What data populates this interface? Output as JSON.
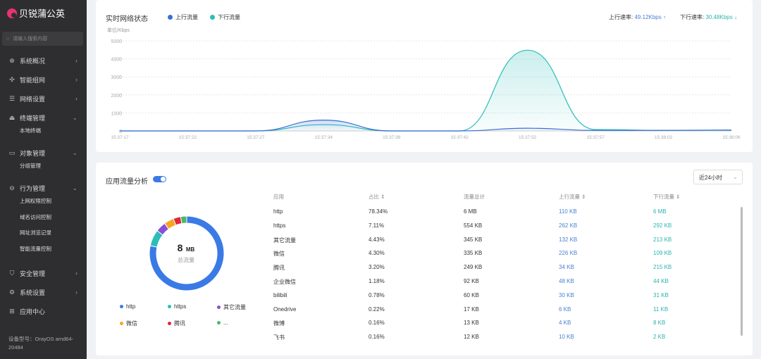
{
  "brand": "贝锐蒲公英",
  "search": {
    "placeholder": "请输入搜索内容"
  },
  "sidebar": {
    "items": [
      {
        "label": "系统概况",
        "icon": "globe-icon",
        "chevron": "right"
      },
      {
        "label": "智能组网",
        "icon": "network-icon",
        "chevron": "right"
      },
      {
        "label": "网络设置",
        "icon": "sliders-icon",
        "chevron": "right"
      },
      {
        "label": "终端管理",
        "icon": "terminal-icon",
        "chevron": "down",
        "children": [
          "本地终端"
        ]
      },
      {
        "label": "对象管理",
        "icon": "folder-icon",
        "chevron": "down",
        "children": [
          "分组管理"
        ]
      },
      {
        "label": "行为管理",
        "icon": "behavior-icon",
        "chevron": "down",
        "children": [
          "上网权限控制",
          "域名访问控制",
          "网址浏览记录",
          "智能流量控制"
        ]
      },
      {
        "label": "安全管理",
        "icon": "shield-icon",
        "chevron": "right"
      },
      {
        "label": "系统设置",
        "icon": "gear-icon",
        "chevron": "right"
      },
      {
        "label": "应用中心",
        "icon": "apps-icon",
        "chevron": ""
      }
    ],
    "device": "设备型号：OrayOS amd64-20484"
  },
  "realtime": {
    "title": "实时网络状态",
    "up_label": "上行流量",
    "down_label": "下行流量",
    "up_rate_label": "上行速率:",
    "up_rate": "49.12Kbps ↑",
    "down_rate_label": "下行速率:",
    "down_rate": "30.48Kbps ↓"
  },
  "chart_data": {
    "type": "area",
    "ylabel": "单位/Kbps",
    "ylim": [
      0,
      5000
    ],
    "yticks": [
      0,
      1000,
      2000,
      3000,
      4000,
      5000
    ],
    "grid": true,
    "legend": "top-left",
    "x": [
      "15:37:17",
      "15:37:22",
      "15:37:27",
      "15:37:34",
      "15:37:38",
      "15:37:42",
      "15:37:52",
      "15:37:57",
      "15:38:02",
      "15:38:06"
    ],
    "series": [
      {
        "name": "上行流量",
        "color": "#3b6fd4",
        "values": [
          0,
          0,
          0,
          600,
          0,
          0,
          150,
          30,
          30,
          50
        ]
      },
      {
        "name": "下行流量",
        "color": "#2bbdb8",
        "values": [
          0,
          0,
          0,
          350,
          0,
          0,
          4480,
          80,
          30,
          40
        ]
      }
    ]
  },
  "apps": {
    "title": "应用流量分析",
    "toggle_on": true,
    "range": "近24小时",
    "total_value": "8",
    "total_unit": "MB",
    "total_label": "总流量",
    "legend": [
      {
        "name": "http",
        "color": "#3b7ae6"
      },
      {
        "name": "https",
        "color": "#2cbdb8"
      },
      {
        "name": "其它流量",
        "color": "#8a4fd8"
      },
      {
        "name": "微信",
        "color": "#f5a623"
      },
      {
        "name": "腾讯",
        "color": "#e3263a"
      },
      {
        "name": "...",
        "color": "#4cb86a"
      }
    ],
    "slices": [
      78.34,
      7.11,
      4.43,
      4.3,
      3.2,
      2.62
    ],
    "columns": [
      "应用",
      "占比 ⇕",
      "流量总计",
      "上行流量 ⇕",
      "下行流量 ⇕"
    ],
    "rows": [
      [
        "http",
        "78.34%",
        "6 MB",
        "110 KB",
        "6 MB"
      ],
      [
        "https",
        "7.11%",
        "554 KB",
        "262 KB",
        "292 KB"
      ],
      [
        "其它流量",
        "4.43%",
        "345 KB",
        "132 KB",
        "213 KB"
      ],
      [
        "微信",
        "4.30%",
        "335 KB",
        "226 KB",
        "109 KB"
      ],
      [
        "腾讯",
        "3.20%",
        "249 KB",
        "34 KB",
        "215 KB"
      ],
      [
        "企业微信",
        "1.18%",
        "92 KB",
        "48 KB",
        "44 KB"
      ],
      [
        "bilibili",
        "0.78%",
        "60 KB",
        "30 KB",
        "31 KB"
      ],
      [
        "Onedrive",
        "0.22%",
        "17 KB",
        "6 KB",
        "11 KB"
      ],
      [
        "微博",
        "0.16%",
        "13 KB",
        "4 KB",
        "8 KB"
      ],
      [
        "飞书",
        "0.16%",
        "12 KB",
        "10 KB",
        "2 KB"
      ]
    ]
  }
}
